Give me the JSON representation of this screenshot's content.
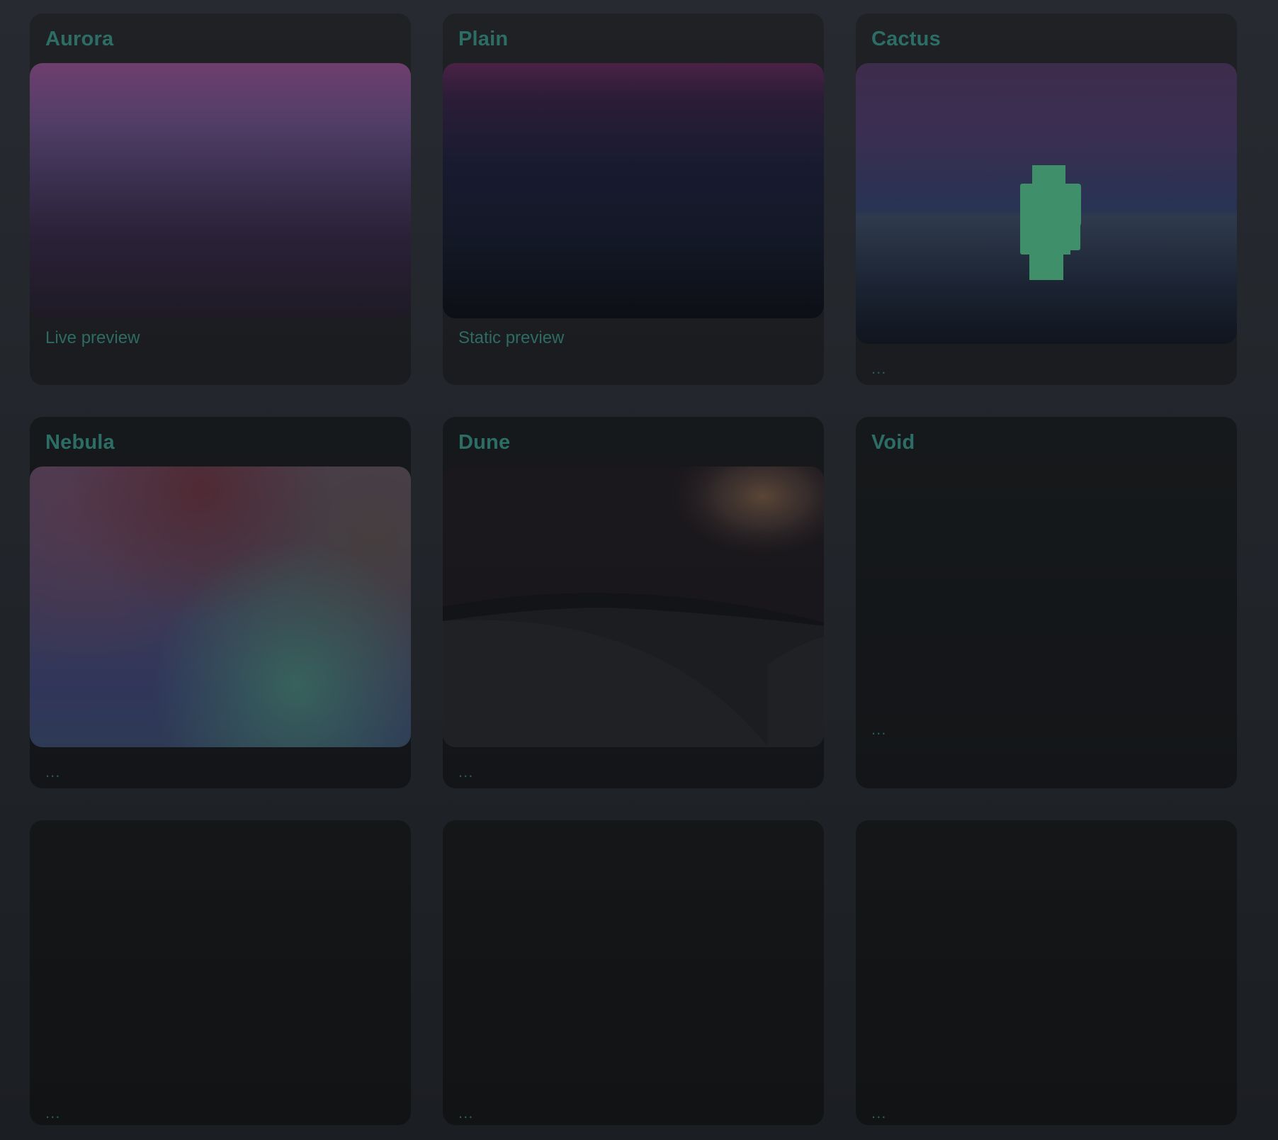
{
  "cards": [
    {
      "title": "Aurora",
      "caption": "Live preview"
    },
    {
      "title": "Plain",
      "caption": "Static preview"
    },
    {
      "title": "Cactus",
      "caption": "..."
    },
    {
      "title": "Nebula",
      "caption": "..."
    },
    {
      "title": "Dune",
      "caption": "..."
    },
    {
      "title": "Void",
      "caption": "..."
    },
    {
      "caption": "..."
    },
    {
      "caption": "..."
    },
    {
      "caption": "..."
    }
  ],
  "colors": {
    "accent": "#2c6e66",
    "page_background": "#24282d",
    "card_background": "#1d1f22",
    "cactus": "#3e8f6a"
  }
}
